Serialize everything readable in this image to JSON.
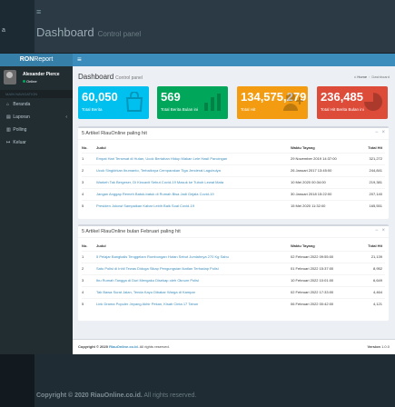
{
  "background": {
    "menu_icon": "hamburger-icon",
    "title": "Dashboard",
    "subtitle": "Control panel",
    "side_text": "a",
    "footer_prefix": "Copyright © 2020",
    "footer_brand": "RiauOnline.co.id.",
    "footer_suffix": "All rights reserved."
  },
  "app": {
    "logo_main": "RON",
    "logo_rest": "Report",
    "menu_icon": "hamburger-icon"
  },
  "user": {
    "name": "Alexander Pierce",
    "status": "Online"
  },
  "sidebar": {
    "header": "MAIN NAVIGATION",
    "items": [
      {
        "label": "Beranda",
        "icon": "home-icon"
      },
      {
        "label": "Laporan",
        "icon": "book-icon"
      },
      {
        "label": "Polling",
        "icon": "bar-chart-icon"
      },
      {
        "label": "Keluar",
        "icon": "sign-out-icon"
      }
    ]
  },
  "header": {
    "title": "Dashboard",
    "subtitle": "Control panel",
    "breadcrumb": [
      "Home",
      "Dashboard"
    ]
  },
  "stats": [
    {
      "value": "60,050",
      "label": "Total Berita",
      "color": "#00c0ef",
      "icon": "shopping-bag-icon"
    },
    {
      "value": "569",
      "label": "Total Berita Bulan ini",
      "color": "#00a65a",
      "icon": "bar-chart-icon"
    },
    {
      "value": "134,575,279",
      "label": "Total Hit",
      "color": "#f39c12",
      "icon": "user-add-icon"
    },
    {
      "value": "236,485",
      "label": "Total Hit Berita Bulan ini",
      "color": "#dd4b39",
      "icon": "pie-chart-icon"
    }
  ],
  "panel1": {
    "title": "5 Artikel RiauOnline paling hit",
    "columns": [
      "No.",
      "Judul",
      "Waktu Tayang",
      "Total Hit"
    ],
    "rows": [
      [
        "1",
        "Empat Hari Tersesat di Hutan, Ucok Bertahan Hidup Makan Lele Hasil Pancingan",
        "29 November 2019 14:37:00",
        "321,272"
      ],
      [
        "2",
        "Ucok Singkirkan Ibumanto, Terbaiknya Cemparakan Tiga Jenderal Lagubulya",
        "26 Januari 2017 13:45:00",
        "244,841"
      ],
      [
        "3",
        "Warkeh Tak Bergeser, Di Kincavit Sebut Covid-19 Masuk ke Tubuh Lewat Mata",
        "10 Mei 2020 00:34:00",
        "219,381"
      ],
      [
        "4",
        "Jangan Anggap Remeh Batuk-batuk di Rumah Bisa Jadi Gejala Covid-19",
        "30 Januari 2018 15:22:00",
        "207,140"
      ],
      [
        "5",
        "Presiden Jokowi Sampaikan Kabar Lebih Baik Soal Covid-19",
        "15 Mei 2020 11:32:00",
        "165,551"
      ]
    ]
  },
  "panel2": {
    "title": "5 Artikel RiauOnline bulan Februari paling hit",
    "columns": [
      "No.",
      "Judul",
      "Waktu Tayang",
      "Total Hit"
    ],
    "rows": [
      [
        "1",
        "5 Pelajar Bangkalis Tenggelam Rombongan Hutan Sebut Jumlahnya 270 Kg Sabu",
        "02 Februari 2022 09:55:00",
        "21,139"
      ],
      [
        "2",
        "Satu Polisi di Inhil Tewas Diduga Sikap Pengungsian Ikatlan Terhadap Polisi",
        "01 Februari 2022 15:37:00",
        "8,952"
      ],
      [
        "3",
        "Ibu Rumah Tangga di Duri Mengaku Disekap oleh Oknum Polisi",
        "10 Februari 2022 10:01:00",
        "6,649"
      ],
      [
        "4",
        "Tak Bawa Surat Jalan, Tenda Kayu Dibakar Warga di Kampar",
        "02 Februari 2022 17:33:00",
        "4,464"
      ],
      [
        "5",
        "Link Drama Populer Jepang Akhir Pekan, Kisah Cinta 17 Tahun",
        "06 Februari 2022 00:42:00",
        "4,121"
      ]
    ]
  },
  "footer": {
    "prefix": "Copyright © 2020",
    "brand": "RiauOnline.co.id.",
    "suffix": "All rights reserved.",
    "version_label": "Version",
    "version": "1.0.0"
  }
}
